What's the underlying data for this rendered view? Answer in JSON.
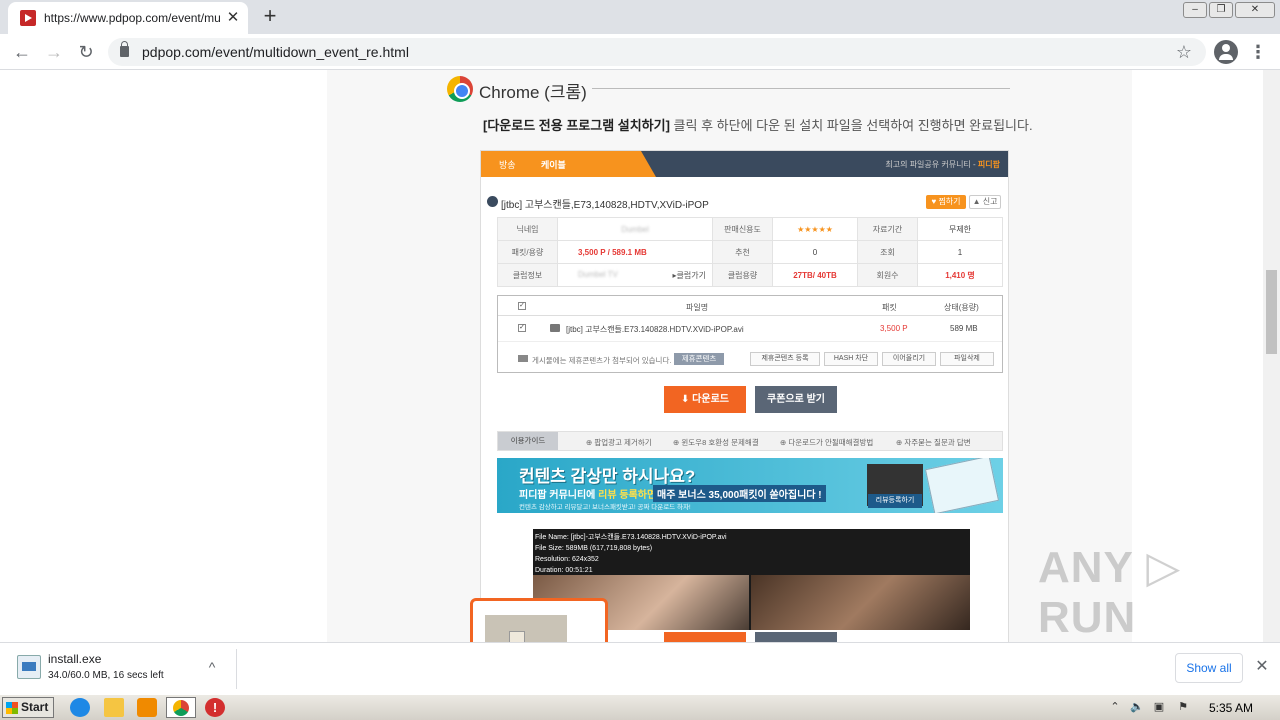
{
  "browser": {
    "tab_title": "https://www.pdpop.com/event/mult",
    "tab_close": "✕",
    "new_tab": "+",
    "url": "pdpop.com/event/multidown_event_re.html",
    "back": "←",
    "forward": "→",
    "reload": "↻",
    "bookmark_star": "☆",
    "menu": "⋮"
  },
  "page": {
    "heading": "Chrome (크롬)",
    "instruction_bold": "[다운로드 전용 프로그램 설치하기]",
    "instruction_rest": " 클릭 후 하단에 다운 된 설치 파일을 선택하여  진행하면 완료됩니다."
  },
  "shot": {
    "tab1": "방송",
    "tab2": "케이블",
    "brand_text": "최고의 파일공유 커뮤니티 - ",
    "brand_name": "피디팝",
    "post_title": "[jtbc] 고부스캔들,E73,140828,HDTV,XViD-iPOP",
    "recommend": "♥ 찜하기",
    "report": "▲ 신고",
    "rows": [
      [
        "닉네임",
        "Dumbel",
        "판매신용도",
        "★★★★★",
        "자료기간",
        "무제한"
      ],
      [
        "패킷/용량",
        "3,500 P / 589.1 MB",
        "추천",
        "0",
        "조회",
        "1"
      ],
      [
        "클럽정보",
        "Dumbel TV",
        "클럽가기",
        "클럽용량",
        "27TB/ 40TB",
        "회원수",
        "1,410 명"
      ]
    ],
    "file_head_name": "파일명",
    "file_head_packet": "패킷",
    "file_head_status": "상태(용량)",
    "file_name": "[jtbc] 고부스캔들.E73.140828.HDTV.XViD-iPOP.avi",
    "file_packet": "3,500 P",
    "file_size": "589 MB",
    "footer_text": "게시물에는 제휴콘텐츠가 첨부되어 있습니다.",
    "footer_badge": "제휴콘텐츠",
    "btn_partner": "제휴콘텐츠 등록",
    "btn_hash": "HASH 차단",
    "btn_resume": "이어올리기",
    "btn_delete": "파일삭제",
    "download_btn": "⬇ 다운로드",
    "coupon_btn": "쿠폰으로 받기",
    "guide_label": "이용가이드",
    "guide_items": [
      "팝업광고 제거하기",
      "윈도우8 호환성 문제해결",
      "다운로드가 안될때해결방법",
      "자주묻는 질문과 답변"
    ],
    "banner_title": "컨텐츠 감상만 하시나요?",
    "banner_sub_pre": "피디팝 커뮤니티에 ",
    "banner_sub_hl": "리뷰 등록하면",
    "banner_bonus": "매주 보너스 35,000패킷이 쏟아집니다 !",
    "banner_small": "컨텐츠 감상하고  리뷰달고!  보너스패킷받고!  공짜 다운로드 하자!",
    "banner_review": "리뷰등록하기",
    "thumb_meta": "File Name: [jtbc]-고부스캔들.E73.140828.HDTV.XViD-iPOP.avi\nFile Size: 589MB (617,719,808 bytes)\nResolution: 624x352\nDuration: 00:51:21"
  },
  "watermark": "ANY ▷ RUN",
  "downloads": {
    "file_name": "install.exe",
    "status": "34.0/60.0 MB, 16 secs left",
    "chevron": "^",
    "show_all": "Show all",
    "close": "✕"
  },
  "taskbar": {
    "start": "Start",
    "clock": "5:35 AM"
  }
}
